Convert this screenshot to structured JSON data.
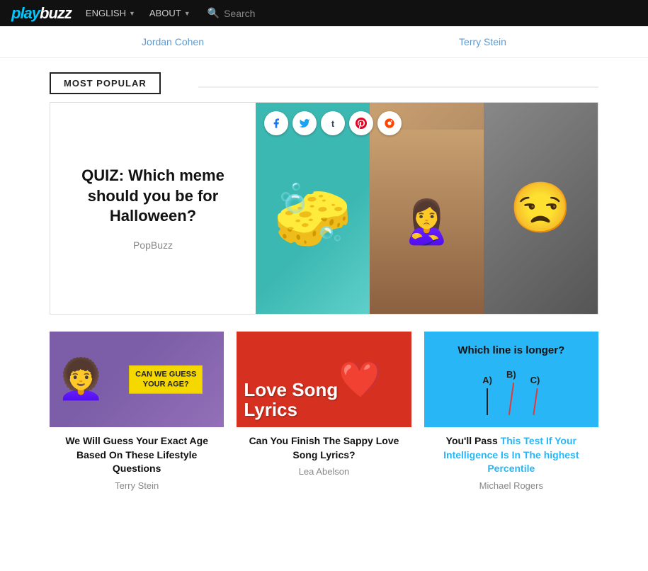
{
  "nav": {
    "logo": "playbuzz",
    "links": [
      {
        "label": "ENGLISH",
        "id": "lang"
      },
      {
        "label": "ABOUT",
        "id": "about"
      }
    ],
    "search_placeholder": "Search"
  },
  "above_fold": {
    "authors": [
      "Jordan Cohen",
      "Terry Stein"
    ]
  },
  "section": {
    "most_popular_label": "MOST POPULAR"
  },
  "featured": {
    "title": "QUIZ: Which meme should you be for Halloween?",
    "author": "PopBuzz",
    "social_icons": [
      "facebook",
      "twitter",
      "tumblr",
      "pinterest",
      "reddit"
    ]
  },
  "cards": [
    {
      "id": "age-card",
      "title": "We Will Guess Your Exact Age Based On These Lifestyle Questions",
      "author": "Terry Stein",
      "badge_line1": "CAN WE GUESS",
      "badge_line2": "YOUR AGE?"
    },
    {
      "id": "love-card",
      "title": "Can You Finish The Sappy Love Song Lyrics?",
      "author": "Lea Abelson",
      "overlay_text_line1": "Love Song",
      "overlay_text_line2": "Lyrics"
    },
    {
      "id": "iq-card",
      "title_part1": "You'll Pass ",
      "title_highlight": "This Test If Your Intelligence Is In The highest Percentile",
      "author": "Michael Rogers",
      "question": "Which line is longer?",
      "options": [
        "A)",
        "B)",
        "C)"
      ]
    }
  ]
}
